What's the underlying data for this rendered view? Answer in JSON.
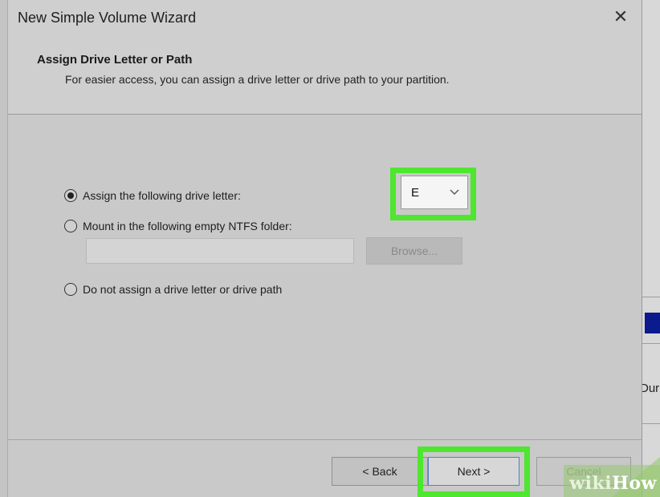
{
  "window": {
    "title": "New Simple Volume Wizard",
    "close_glyph": "✕"
  },
  "header": {
    "title": "Assign Drive Letter or Path",
    "subtitle": "For easier access, you can assign a drive letter or drive path to your partition."
  },
  "options": {
    "assign_letter": {
      "label": "Assign the following drive letter:",
      "selected": true
    },
    "mount_folder": {
      "label": "Mount in the following empty NTFS folder:",
      "selected": false
    },
    "no_assign": {
      "label": "Do not assign a drive letter or drive path",
      "selected": false
    }
  },
  "drive_letter_select": {
    "value": "E",
    "chevron_icon": "chevron-down-icon"
  },
  "folder_path_input": {
    "value": ""
  },
  "buttons": {
    "browse": "Browse...",
    "back": "< Back",
    "next": "Next >",
    "cancel": "Cancel"
  },
  "background_window": {
    "partial_text": "Dur"
  },
  "watermark": {
    "text_wiki": "wiki",
    "text_how": "How"
  },
  "colors": {
    "highlight": "#4ee62e",
    "background_blue": "#0b1a8c"
  }
}
